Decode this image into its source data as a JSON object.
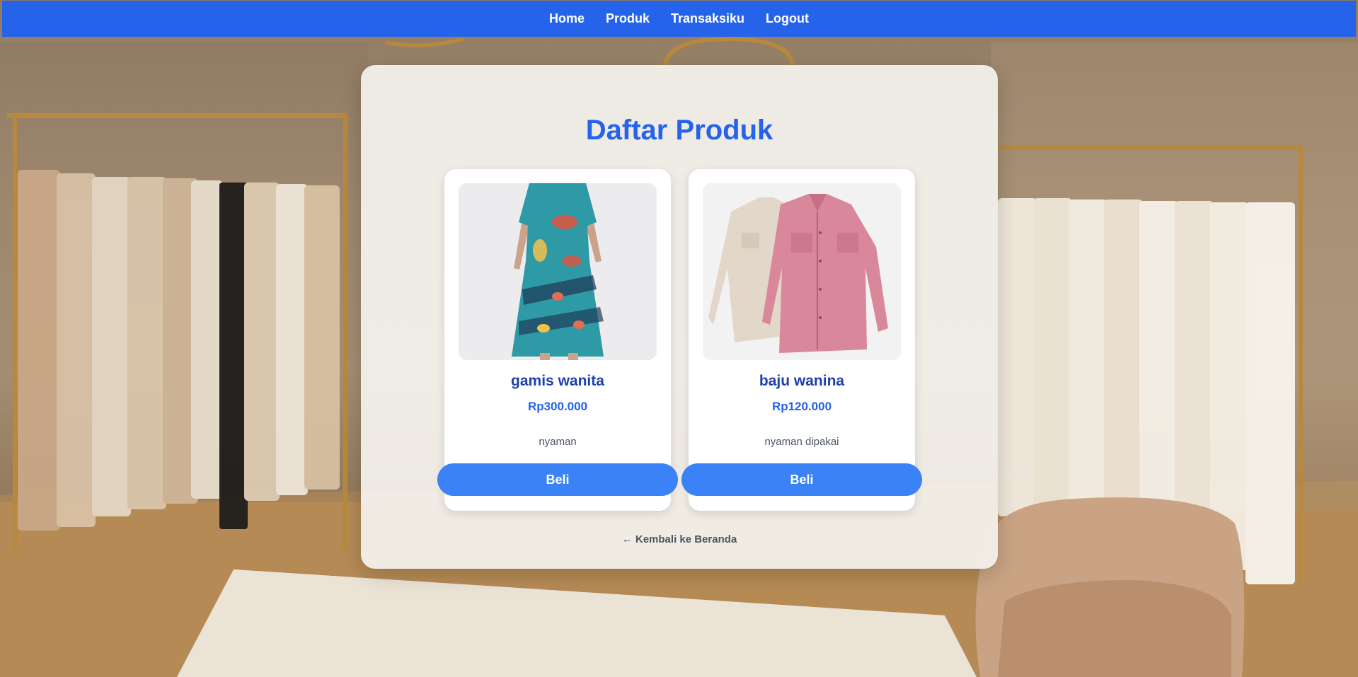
{
  "nav": {
    "items": [
      {
        "label": "Home"
      },
      {
        "label": "Produk"
      },
      {
        "label": "Transaksiku"
      },
      {
        "label": "Logout"
      }
    ]
  },
  "main": {
    "title": "Daftar Produk",
    "products": [
      {
        "name": "gamis wanita",
        "price": "Rp300.000",
        "description": "nyaman",
        "buy_label": "Beli",
        "image": "teal-batik-dress-photo"
      },
      {
        "name": "baju wanina",
        "price": "Rp120.000",
        "description": "nyaman dipakai",
        "buy_label": "Beli",
        "image": "pink-and-cream-shirts-photo"
      }
    ],
    "back_link": "← Kembali ke Beranda"
  },
  "colors": {
    "navbar": "#2563eb",
    "title": "#2563eb",
    "product_name": "#1e40af",
    "price": "#2563eb",
    "button": "#3b82f6"
  }
}
